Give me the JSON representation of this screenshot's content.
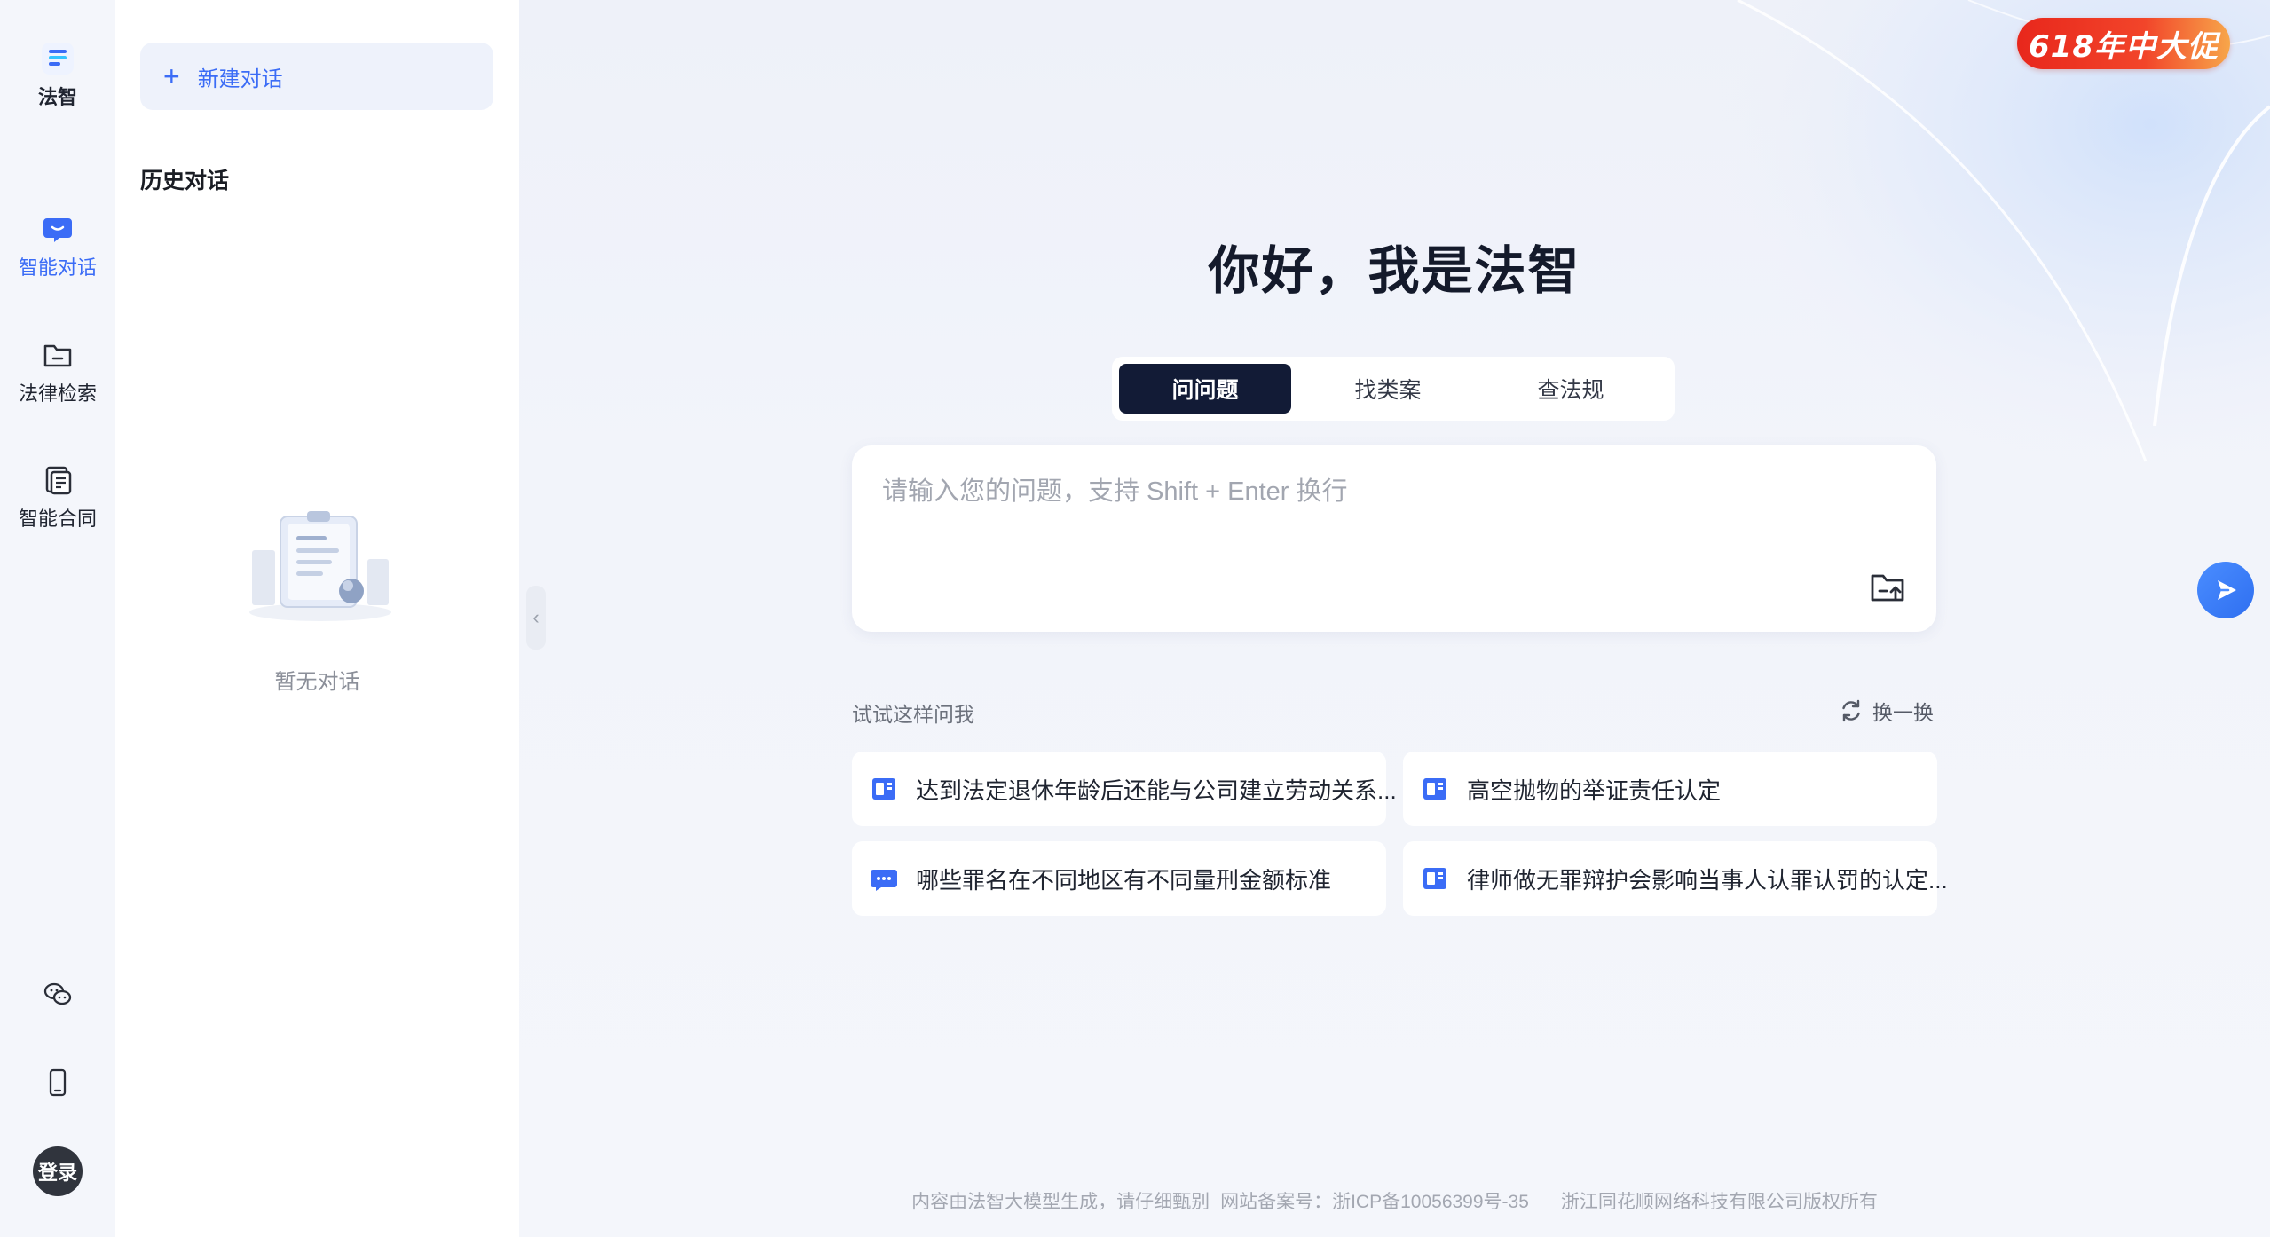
{
  "rail": {
    "logo_label": "法智",
    "items": [
      {
        "label": "智能对话"
      },
      {
        "label": "法律检索"
      },
      {
        "label": "智能合同"
      }
    ],
    "login_label": "登录"
  },
  "history": {
    "new_chat_label": "新建对话",
    "title": "历史对话",
    "empty_text": "暂无对话"
  },
  "promo": {
    "text": "618年中大促"
  },
  "main": {
    "greeting": "你好，我是法智",
    "tabs": [
      {
        "label": "问问题"
      },
      {
        "label": "找类案"
      },
      {
        "label": "查法规"
      }
    ],
    "input_placeholder": "请输入您的问题，支持 Shift + Enter 换行",
    "try_label": "试试这样问我",
    "refresh_label": "换一换",
    "suggestions": [
      {
        "text": "达到法定退休年龄后还能与公司建立劳动关系..."
      },
      {
        "text": "高空抛物的举证责任认定"
      },
      {
        "text": "哪些罪名在不同地区有不同量刑金额标准"
      },
      {
        "text": "律师做无罪辩护会影响当事人认罪认罚的认定..."
      }
    ]
  },
  "footer": {
    "notice": "内容由法智大模型生成，请仔细甄别",
    "icp": "网站备案号：浙ICP备10056399号-35",
    "copyright": "浙江同花顺网络科技有限公司版权所有"
  },
  "colors": {
    "accent": "#3b6cf6",
    "tab_active_bg": "#121b36",
    "promo_red": "#e8271c"
  }
}
